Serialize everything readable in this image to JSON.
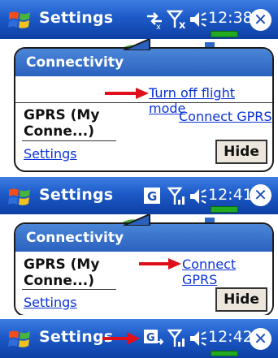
{
  "panels": [
    {
      "title": "Settings",
      "time": "12:38",
      "popup": {
        "heading": "Connectivity",
        "flight_mode_link": "Turn off flight mode",
        "connection_name": "GPRS (My Conne...)",
        "connection_line1": "GPRS (My",
        "connection_line2": "Conne...)",
        "connect_link": "Connect GPRS",
        "settings_link": "Settings",
        "hide_button": "Hide"
      }
    },
    {
      "title": "Settings",
      "time": "12:41",
      "popup": {
        "heading": "Connectivity",
        "connection_line1": "GPRS (My",
        "connection_line2": "Conne...)",
        "connect_link": "Connect GPRS",
        "settings_link": "Settings",
        "hide_button": "Hide"
      }
    },
    {
      "title": "Settings",
      "time": "12:42"
    }
  ],
  "colors": {
    "titlebar": "#1d5ac8",
    "link": "#0a33d8",
    "arrow": "#e0101a",
    "battery": "#22aa22"
  },
  "icons": {
    "start": "windows-start-icon",
    "signal_off": "signal-off-icon",
    "sync": "sync-icon",
    "speaker": "speaker-icon",
    "gprs": "gprs-icon",
    "close": "close-icon"
  }
}
